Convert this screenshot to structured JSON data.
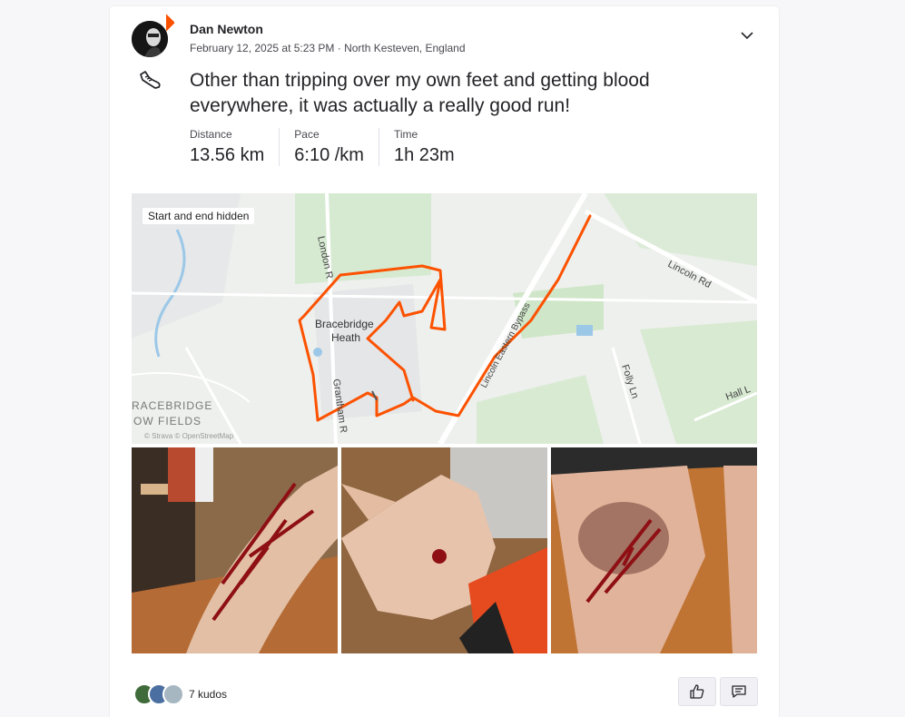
{
  "athlete": {
    "name": "Dan Newton",
    "date_location": "February 12, 2025 at 5:23 PM · North Kesteven, England"
  },
  "activity": {
    "sport_icon": "running-shoe-icon",
    "title": "Other than tripping over my own feet and getting blood everywhere, it was actually a really good run!",
    "stats": [
      {
        "label": "Distance",
        "value": "13.56 km"
      },
      {
        "label": "Pace",
        "value": "6:10 /km"
      },
      {
        "label": "Time",
        "value": "1h 23m"
      }
    ]
  },
  "map": {
    "hidden_label": "Start and end hidden",
    "place_label_1": "Bracebridge",
    "place_label_2": "Heath",
    "road_london": "London R",
    "road_lincoln": "Lincoln Rd",
    "road_bypass": "Lincoln Eastern Bypass",
    "road_folly": "Folly Ln",
    "road_grantham": "Grantham R",
    "road_hall": "Hall L",
    "area_1": "RACEBRIDGE",
    "area_2": "OW FIELDS",
    "attribution": "© Strava © OpenStreetMap",
    "route_color": "#fc5200"
  },
  "photos": [
    {
      "name": "photo-leg-wound"
    },
    {
      "name": "photo-hand-wound"
    },
    {
      "name": "photo-knee-wound"
    }
  ],
  "kudos": {
    "count_label": "7 kudos"
  },
  "colors": {
    "brand": "#fc5200",
    "text": "#242428",
    "muted": "#494950"
  }
}
